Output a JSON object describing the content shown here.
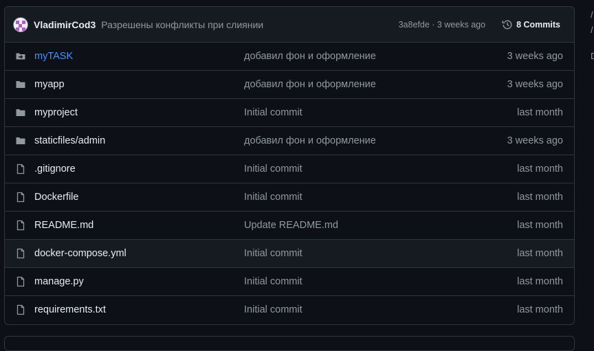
{
  "commit": {
    "author": "VladimirCod3",
    "message": "Разрешены конфликты при слиянии",
    "sha_time": "3a8efde · 3 weeks ago",
    "commits_label": "8 Commits"
  },
  "files": [
    {
      "name": "myTASK",
      "type": "submodule",
      "message": "добавил фон и оформление",
      "date": "3 weeks ago"
    },
    {
      "name": "myapp",
      "type": "folder",
      "message": "добавил фон и оформление",
      "date": "3 weeks ago"
    },
    {
      "name": "myproject",
      "type": "folder",
      "message": "Initial commit",
      "date": "last month"
    },
    {
      "name": "staticfiles/admin",
      "type": "folder",
      "message": "добавил фон и оформление",
      "date": "3 weeks ago"
    },
    {
      "name": ".gitignore",
      "type": "file",
      "message": "Initial commit",
      "date": "last month"
    },
    {
      "name": "Dockerfile",
      "type": "file",
      "message": "Initial commit",
      "date": "last month"
    },
    {
      "name": "README.md",
      "type": "file",
      "message": "Update README.md",
      "date": "last month"
    },
    {
      "name": "docker-compose.yml",
      "type": "file",
      "message": "Initial commit",
      "date": "last month"
    },
    {
      "name": "manage.py",
      "type": "file",
      "message": "Initial commit",
      "date": "last month"
    },
    {
      "name": "requirements.txt",
      "type": "file",
      "message": "Initial commit",
      "date": "last month"
    }
  ],
  "colors": {
    "background": "#0d1117",
    "row_highlight": "#161b22",
    "border": "#30363d",
    "link": "#4493f8",
    "muted": "#9198a1",
    "text": "#e6edf3"
  },
  "icons": {
    "submodule": "file-submodule-icon",
    "folder": "folder-icon",
    "file": "file-icon",
    "history": "history-icon"
  }
}
